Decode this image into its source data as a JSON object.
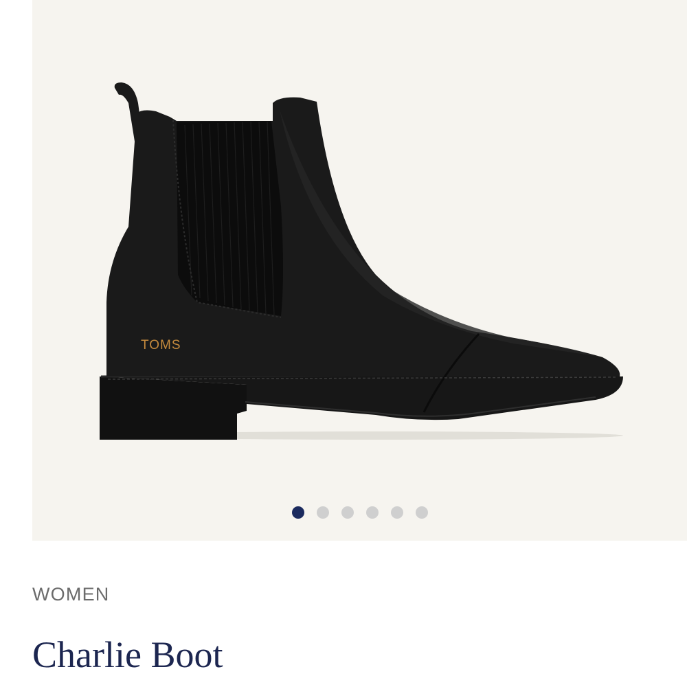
{
  "colors": {
    "gallery_background": "#f6f4ef",
    "active_dot": "#1b2a5e",
    "inactive_dot": "#cfcfcf",
    "title": "#1c2650",
    "category": "#6b6b6b",
    "logo_color": "#c58a3d"
  },
  "gallery": {
    "image_alt": "Charlie Boot",
    "logo_text": "TOMS",
    "slide_count": 6,
    "active_slide": 1
  },
  "product": {
    "category": "WOMEN",
    "title": "Charlie Boot"
  }
}
